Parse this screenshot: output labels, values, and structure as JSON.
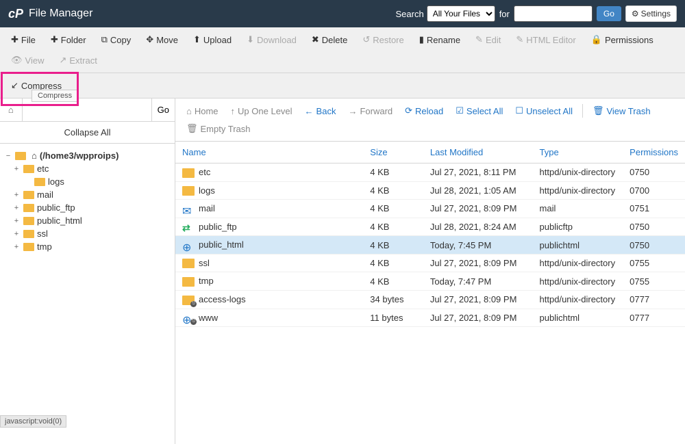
{
  "header": {
    "app_title": "File Manager",
    "search_label": "Search",
    "search_scope_selected": "All Your Files",
    "for_label": "for",
    "search_value": "",
    "go_label": "Go",
    "settings_label": "Settings"
  },
  "toolbar": {
    "items": [
      {
        "label": "File",
        "icon": "plus-icon",
        "disabled": false
      },
      {
        "label": "Folder",
        "icon": "plus-icon",
        "disabled": false
      },
      {
        "label": "Copy",
        "icon": "copy-icon",
        "disabled": false
      },
      {
        "label": "Move",
        "icon": "move-icon",
        "disabled": false
      },
      {
        "label": "Upload",
        "icon": "upload-icon",
        "disabled": false
      },
      {
        "label": "Download",
        "icon": "download-icon",
        "disabled": true
      },
      {
        "label": "Delete",
        "icon": "delete-icon",
        "disabled": false
      },
      {
        "label": "Restore",
        "icon": "restore-icon",
        "disabled": true
      },
      {
        "label": "Rename",
        "icon": "rename-icon",
        "disabled": false
      },
      {
        "label": "Edit",
        "icon": "edit-icon",
        "disabled": true
      },
      {
        "label": "HTML Editor",
        "icon": "html-icon",
        "disabled": true
      },
      {
        "label": "Permissions",
        "icon": "lock-icon",
        "disabled": false
      },
      {
        "label": "View",
        "icon": "eye-icon",
        "disabled": true
      },
      {
        "label": "Extract",
        "icon": "extract-icon",
        "disabled": true
      }
    ],
    "compress_label": "Compress",
    "compress_tooltip": "Compress"
  },
  "sidebar": {
    "path_value": "",
    "go_label": "Go",
    "collapse_all_label": "Collapse All",
    "root_label": "(/home3/wpproips)",
    "items": [
      {
        "label": "etc",
        "expanded": true,
        "children": [
          {
            "label": "logs"
          }
        ]
      },
      {
        "label": "mail"
      },
      {
        "label": "public_ftp"
      },
      {
        "label": "public_html"
      },
      {
        "label": "ssl"
      },
      {
        "label": "tmp"
      }
    ]
  },
  "actions": {
    "home": "Home",
    "up": "Up One Level",
    "back": "Back",
    "forward": "Forward",
    "reload": "Reload",
    "select_all": "Select All",
    "unselect_all": "Unselect All",
    "view_trash": "View Trash",
    "empty_trash": "Empty Trash"
  },
  "table": {
    "columns": {
      "name": "Name",
      "size": "Size",
      "modified": "Last Modified",
      "type": "Type",
      "perms": "Permissions"
    },
    "rows": [
      {
        "icon": "folder",
        "name": "etc",
        "size": "4 KB",
        "modified": "Jul 27, 2021, 8:11 PM",
        "type": "httpd/unix-directory",
        "perms": "0750",
        "selected": false
      },
      {
        "icon": "folder",
        "name": "logs",
        "size": "4 KB",
        "modified": "Jul 28, 2021, 1:05 AM",
        "type": "httpd/unix-directory",
        "perms": "0700",
        "selected": false
      },
      {
        "icon": "mail",
        "name": "mail",
        "size": "4 KB",
        "modified": "Jul 27, 2021, 8:09 PM",
        "type": "mail",
        "perms": "0751",
        "selected": false
      },
      {
        "icon": "arrows",
        "name": "public_ftp",
        "size": "4 KB",
        "modified": "Jul 28, 2021, 8:24 AM",
        "type": "publicftp",
        "perms": "0750",
        "selected": false
      },
      {
        "icon": "globe",
        "name": "public_html",
        "size": "4 KB",
        "modified": "Today, 7:45 PM",
        "type": "publichtml",
        "perms": "0750",
        "selected": true
      },
      {
        "icon": "folder",
        "name": "ssl",
        "size": "4 KB",
        "modified": "Jul 27, 2021, 8:09 PM",
        "type": "httpd/unix-directory",
        "perms": "0755",
        "selected": false
      },
      {
        "icon": "folder",
        "name": "tmp",
        "size": "4 KB",
        "modified": "Today, 7:47 PM",
        "type": "httpd/unix-directory",
        "perms": "0755",
        "selected": false
      },
      {
        "icon": "folder-link",
        "name": "access-logs",
        "size": "34 bytes",
        "modified": "Jul 27, 2021, 8:09 PM",
        "type": "httpd/unix-directory",
        "perms": "0777",
        "selected": false
      },
      {
        "icon": "globe-link",
        "name": "www",
        "size": "11 bytes",
        "modified": "Jul 27, 2021, 8:09 PM",
        "type": "publichtml",
        "perms": "0777",
        "selected": false
      }
    ]
  },
  "status_bar": "javascript:void(0)"
}
